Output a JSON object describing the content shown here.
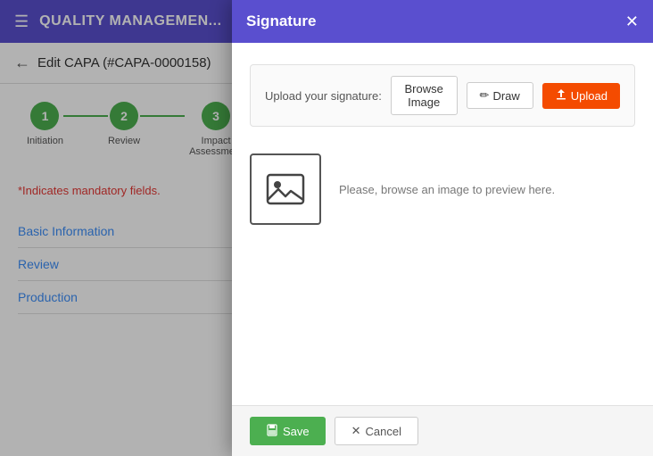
{
  "header": {
    "title": "QUALITY MANAGEMEN...",
    "hamburger": "☰"
  },
  "subheader": {
    "back_arrow": "←",
    "title": "Edit CAPA (#CAPA-0000158)"
  },
  "stepper": {
    "steps": [
      {
        "number": "1",
        "label": "Initiation"
      },
      {
        "number": "2",
        "label": "Review"
      },
      {
        "number": "3",
        "label": "Impact Assessment"
      }
    ]
  },
  "content": {
    "mandatory_note": "*Indicates mandatory fields.",
    "sections": [
      {
        "label": "Basic Information"
      },
      {
        "label": "Review"
      },
      {
        "label": "Production"
      }
    ]
  },
  "modal": {
    "title": "Signature",
    "close": "✕",
    "upload_label": "Upload your signature:",
    "browse_btn": "Browse Image",
    "draw_btn": "Draw",
    "upload_btn": "Upload",
    "preview_text": "Please, browse an image to preview here.",
    "save_btn": "Save",
    "cancel_btn": "Cancel",
    "pencil_icon": "✏",
    "upload_icon": "⬆"
  }
}
